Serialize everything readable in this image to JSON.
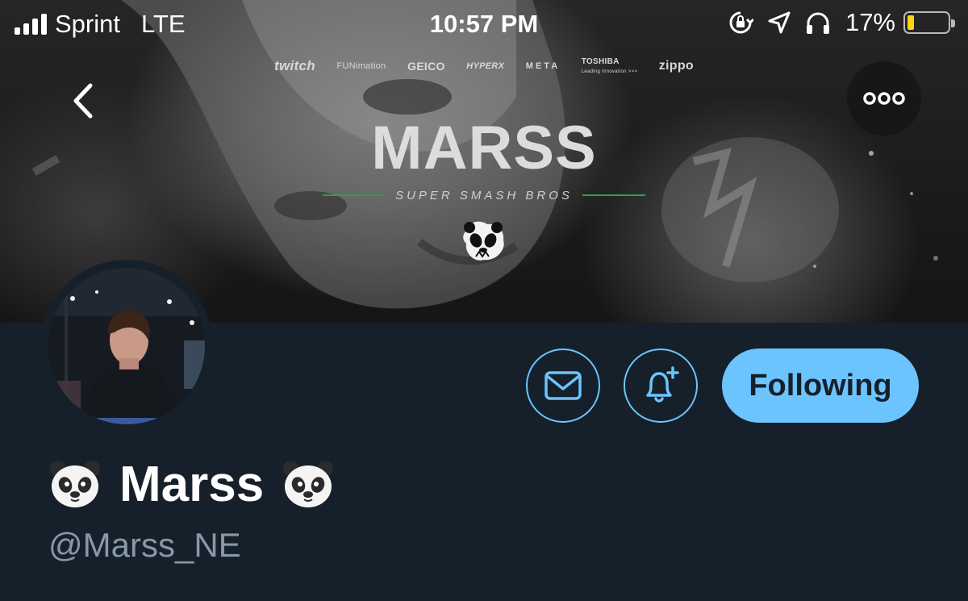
{
  "status_bar": {
    "carrier": "Sprint",
    "network": "LTE",
    "time": "10:57 PM",
    "battery_percent": "17%",
    "battery_level": 0.17,
    "icons": [
      "rotation-lock-icon",
      "location-icon",
      "headphones-icon"
    ]
  },
  "banner": {
    "sponsors": [
      "twitch",
      "FUNimation",
      "GEICO",
      "HYPERX",
      "META",
      "TOSHIBA",
      "zippo"
    ],
    "sponsor_tagline": "Leading Innovation >>>",
    "title": "MARSS",
    "subtitle": "SUPER SMASH BROS",
    "accent_line_color": "#2fa040"
  },
  "nav": {
    "back_icon": "chevron-left-icon",
    "more_icon": "more-horizontal-icon"
  },
  "actions": {
    "message_icon": "mail-icon",
    "notify_icon": "bell-plus-icon",
    "following_label": "Following",
    "accent_color": "#6cc4ff"
  },
  "profile": {
    "display_name": "Marss",
    "name_emoji": "panda-face-icon",
    "handle": "@Marss_NE"
  },
  "colors": {
    "background": "#15202b",
    "secondary_text": "#8899a6"
  }
}
